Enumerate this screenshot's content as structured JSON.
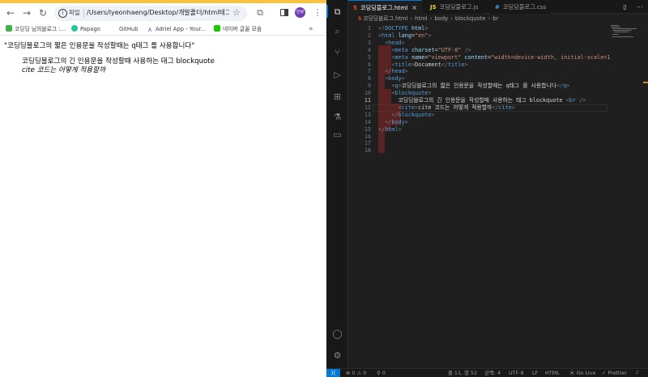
{
  "browser": {
    "toolbar": {
      "back": "←",
      "forward": "→",
      "reload": "↻",
      "info": "i",
      "scheme_label": "파일",
      "url": "/Users/lyeonhaeng/Desktop/개발폴더/html태그적...",
      "star": "☆",
      "extensions": "⧉",
      "profile": "안녕",
      "menu": "⋮"
    },
    "bookmarks": [
      {
        "label": "코딩딩 님의블로그 :...",
        "color": "#3fb44a"
      },
      {
        "label": "Papago",
        "color": "#20c997"
      },
      {
        "label": "GitHub",
        "color": "#ffffff"
      },
      {
        "label": "Adriel App - Your...",
        "color": "#ffffff"
      },
      {
        "label": "네이버 글꼴 모음",
        "color": "#1ec800"
      }
    ],
    "bookmarks_more": "»",
    "page": {
      "quote": "\"코딩딩블로그의 짧은 인용문을 작성할때는 q태그 를 사용합니다\"",
      "blockquote": "코딩딩블로그의 긴 인용문을 작성할때 사용하는 태그 blockquote",
      "cite": "cite 코드는 어떻게 적용할까"
    }
  },
  "vscode": {
    "tabs": [
      {
        "label": "코딩딩블로그.html",
        "icon": "html-file-icon",
        "glyph": "5",
        "color": "#e44d26",
        "active": true
      },
      {
        "label": "코딩딩블로그.js",
        "icon": "js-file-icon",
        "glyph": "JS",
        "color": "#f1dd35",
        "active": false
      },
      {
        "label": "코딩딩블로그.css",
        "icon": "css-file-icon",
        "glyph": "#",
        "color": "#42a5f5",
        "active": false
      }
    ],
    "breadcrumb": [
      "코딩딩블로그.html",
      "html",
      "body",
      "blockquote",
      "br"
    ],
    "line_numbers": [
      "1",
      "2",
      "3",
      "4",
      "5",
      "6",
      "7",
      "8",
      "9",
      "10",
      "11",
      "12",
      "13",
      "14",
      "15",
      "16",
      "17",
      "18"
    ],
    "current_line": "11",
    "status": {
      "remote": "⟩⟨",
      "problems": "⊗ 0 ⚠ 0",
      "ports": "⚲ 0",
      "position": "줄 11, 열 52",
      "spaces": "공백: 4",
      "encoding": "UTF-8",
      "eol": "LF",
      "language": "HTML",
      "golive": "Go Live",
      "prettier": "✓ Prettier",
      "bell": "🔔"
    }
  }
}
